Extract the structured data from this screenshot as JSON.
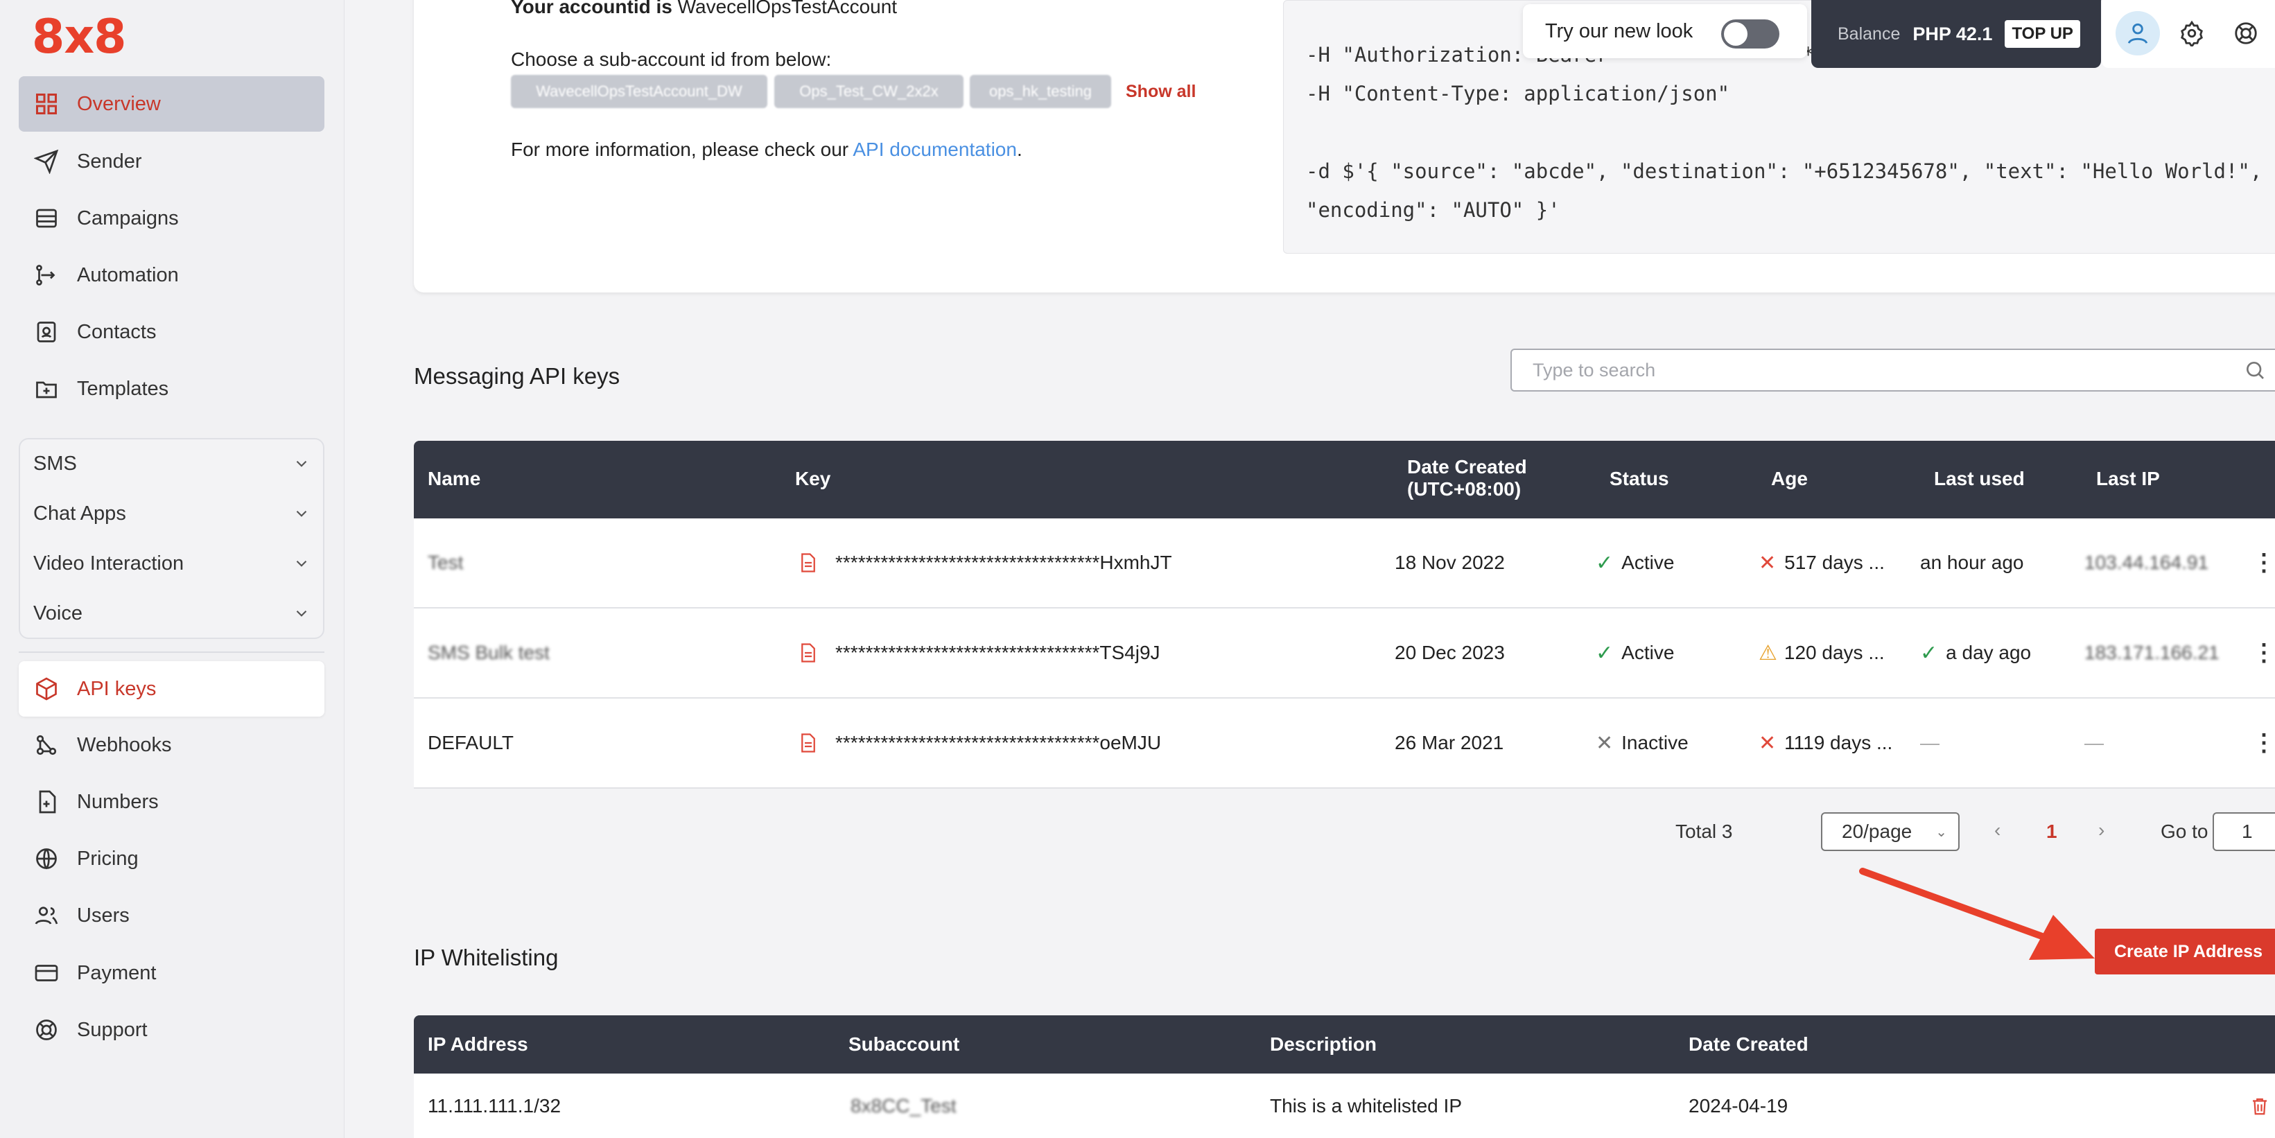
{
  "brand": {
    "logo": "8x8",
    "accent": "#c8372a"
  },
  "sidebar": {
    "items": [
      {
        "label": "Overview",
        "icon": "grid-icon"
      },
      {
        "label": "Sender",
        "icon": "send-icon"
      },
      {
        "label": "Campaigns",
        "icon": "stack-icon"
      },
      {
        "label": "Automation",
        "icon": "flow-icon"
      },
      {
        "label": "Contacts",
        "icon": "contacts-icon"
      },
      {
        "label": "Templates",
        "icon": "folder-plus-icon"
      }
    ],
    "groups": [
      {
        "label": "SMS"
      },
      {
        "label": "Chat Apps"
      },
      {
        "label": "Video Interaction"
      },
      {
        "label": "Voice"
      }
    ],
    "bottom_items": [
      {
        "label": "API keys",
        "icon": "cube-icon"
      },
      {
        "label": "Webhooks",
        "icon": "webhook-icon"
      },
      {
        "label": "Numbers",
        "icon": "doc-plus-icon"
      },
      {
        "label": "Pricing",
        "icon": "globe-icon"
      },
      {
        "label": "Users",
        "icon": "users-icon"
      },
      {
        "label": "Payment",
        "icon": "card-icon"
      },
      {
        "label": "Support",
        "icon": "lifebuoy-icon"
      }
    ]
  },
  "topbar": {
    "try_new_look": "Try our new look",
    "balance_label": "Balance",
    "balance_amount": "PHP 42.1",
    "topup_label": "TOP UP"
  },
  "account": {
    "accountid_prefix": "Your accountid is",
    "accountid": "WavecellOpsTestAccount",
    "choose_label": "Choose a sub-account id from below:",
    "subaccounts": [
      "WavecellOpsTestAccount_DW",
      "Ops_Test_CW_2x2x",
      "ops_hk_testing"
    ],
    "show_all": "Show all",
    "more_info_prefix": "For more information, please check our",
    "api_doc_link": "API documentation",
    "more_info_suffix": "."
  },
  "code_sample": {
    "line1": "-H \"Authorization: Bearer ******************************",
    "line2": "-H \"Content-Type: application/json\"",
    "line3": "",
    "line4": "-d $'{ \"source\": \"abcde\", \"destination\": \"+6512345678\", \"text\": \"Hello World!\",",
    "line5": "\"encoding\": \"AUTO\" }'"
  },
  "api_keys": {
    "title": "Messaging API keys",
    "search_placeholder": "Type to search",
    "columns": {
      "name": "Name",
      "key": "Key",
      "date_created": "Date Created\n(UTC+08:00)",
      "status": "Status",
      "age": "Age",
      "last_used": "Last used",
      "last_ip": "Last IP"
    },
    "rows": [
      {
        "name": "Test",
        "key": "***********************************HxmhJT",
        "date": "18 Nov 2022",
        "status": "Active",
        "age": "517 days ...",
        "last_used": "an hour ago",
        "last_ip": "103.44.164.91"
      },
      {
        "name": "SMS Bulk test",
        "key": "***********************************TS4j9J",
        "date": "20 Dec 2023",
        "status": "Active",
        "age": "120 days ...",
        "last_used": "a day ago",
        "last_ip": "183.171.166.21"
      },
      {
        "name": "DEFAULT",
        "key": "***********************************oeMJU",
        "date": "26 Mar 2021",
        "status": "Inactive",
        "age": "1119 days ...",
        "last_used": "—",
        "last_ip": "—"
      }
    ],
    "pagination": {
      "total_label": "Total 3",
      "page_size": "20/page",
      "current_page": "1",
      "goto_label": "Go to",
      "goto_value": "1"
    }
  },
  "ip_whitelist": {
    "title": "IP Whitelisting",
    "create_button": "Create IP Address",
    "columns": {
      "ip": "IP Address",
      "subaccount": "Subaccount",
      "description": "Description",
      "date": "Date Created"
    },
    "rows": [
      {
        "ip": "11.111.111.1/32",
        "subaccount": "8x8CC_Test",
        "description": "This is a whitelisted IP",
        "date": "2024-04-19"
      }
    ]
  }
}
